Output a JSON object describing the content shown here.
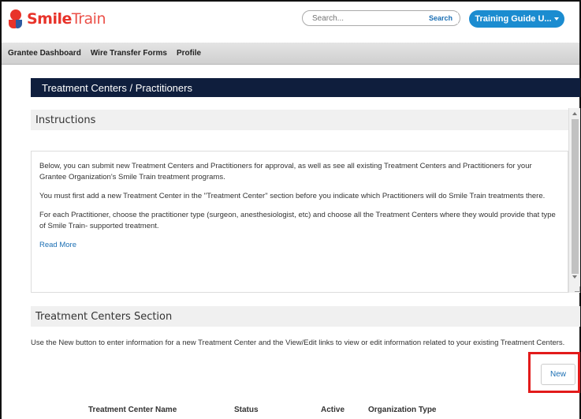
{
  "logo": {
    "text_bold": "Smile",
    "text_light": "Train"
  },
  "search": {
    "placeholder": "Search...",
    "button_label": "Search"
  },
  "guide_menu": {
    "label": "Training Guide U..."
  },
  "nav": {
    "items": [
      {
        "label": "Grantee Dashboard"
      },
      {
        "label": "Wire Transfer Forms"
      },
      {
        "label": "Profile"
      }
    ]
  },
  "page": {
    "title": "Treatment Centers / Practitioners",
    "instructions_heading": "Instructions",
    "instructions": [
      "Below, you can submit new Treatment Centers and Practitioners for approval, as well as see all existing Treatment Centers and Practitioners for your Grantee Organization's Smile Train treatment programs.",
      "You must first add a new Treatment Center in the \"Treatment Center\" section before you indicate which Practitioners will do Smile Train treatments there.",
      "For each Practitioner, choose the practitioner type (surgeon, anesthesiologist, etc) and choose all the Treatment Centers where they would provide that type of Smile Train- supported treatment."
    ],
    "read_more": "Read More",
    "tc_section_heading": "Treatment Centers Section",
    "tc_description": "Use the New button to enter information for a new Treatment Center and the View/Edit links to view or edit information related to your existing Treatment Centers.",
    "new_button": "New",
    "table_columns": [
      {
        "label": "Treatment Center Name"
      },
      {
        "label": "Status"
      },
      {
        "label": "Active"
      },
      {
        "label": "Organization Type"
      }
    ]
  },
  "colors": {
    "accent": "#1b8cd0",
    "title_bar": "#0f1e3d",
    "brand_red": "#e8332a",
    "highlight": "#e21b1b"
  }
}
